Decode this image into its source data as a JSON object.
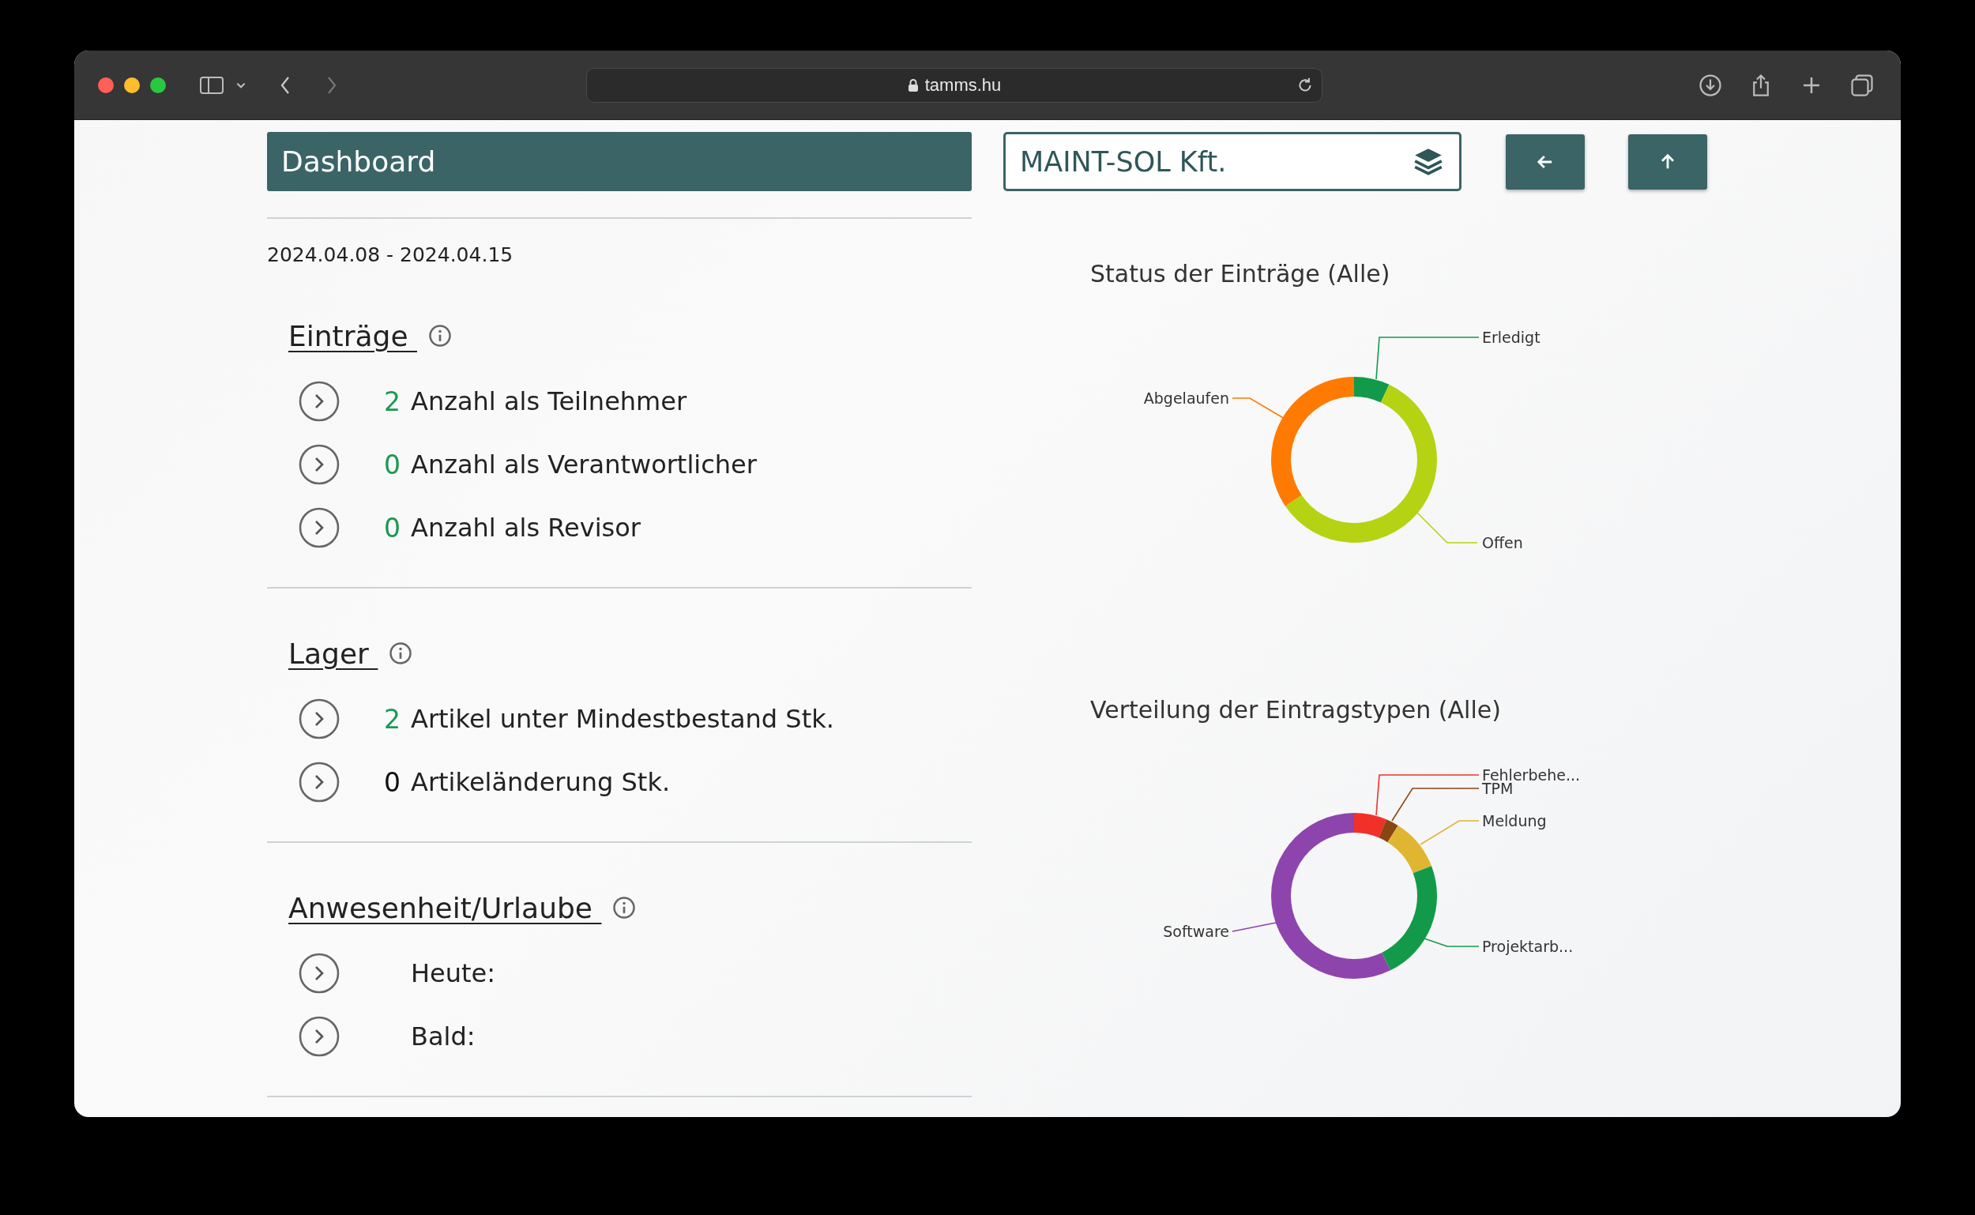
{
  "browser": {
    "url": "tamms.hu"
  },
  "header": {
    "title": "Dashboard"
  },
  "company": {
    "value": "MAINT-SOL Kft."
  },
  "date_range": "2024.04.08 - 2024.04.15",
  "sections": [
    {
      "title": "Einträge",
      "rows": [
        {
          "count": "2",
          "color": "#1a9a50",
          "label": "Anzahl als Teilnehmer"
        },
        {
          "count": "0",
          "color": "#1a9a50",
          "label": "Anzahl als Verantwortlicher"
        },
        {
          "count": "0",
          "color": "#1a9a50",
          "label": "Anzahl als Revisor"
        }
      ]
    },
    {
      "title": "Lager",
      "rows": [
        {
          "count": "2",
          "color": "#1a9a50",
          "label": "Artikel unter Mindestbestand Stk."
        },
        {
          "count": "0",
          "color": "#111111",
          "label": "Artikeländerung Stk."
        }
      ]
    },
    {
      "title": "Anwesenheit/Urlaube",
      "rows": [
        {
          "label": "Heute:"
        },
        {
          "label": "Bald:"
        }
      ]
    }
  ],
  "charts": [
    {
      "title": "Status der Einträge (Alle)",
      "slices": [
        {
          "label": "Erledigt",
          "color": "#129a4a"
        },
        {
          "label": "Offen",
          "color": "#b5d312"
        },
        {
          "label": "Abgelaufen",
          "color": "#ff7a00"
        }
      ]
    },
    {
      "title": "Verteilung der Eintragstypen (Alle)",
      "slices": [
        {
          "label": "Fehlerbehe...",
          "color": "#f2302a"
        },
        {
          "label": "TPM",
          "color": "#8b4513"
        },
        {
          "label": "Meldung",
          "color": "#e0b531"
        },
        {
          "label": "Projektarb...",
          "color": "#129a4a"
        },
        {
          "label": "Software",
          "color": "#8e44ad"
        }
      ]
    }
  ]
}
